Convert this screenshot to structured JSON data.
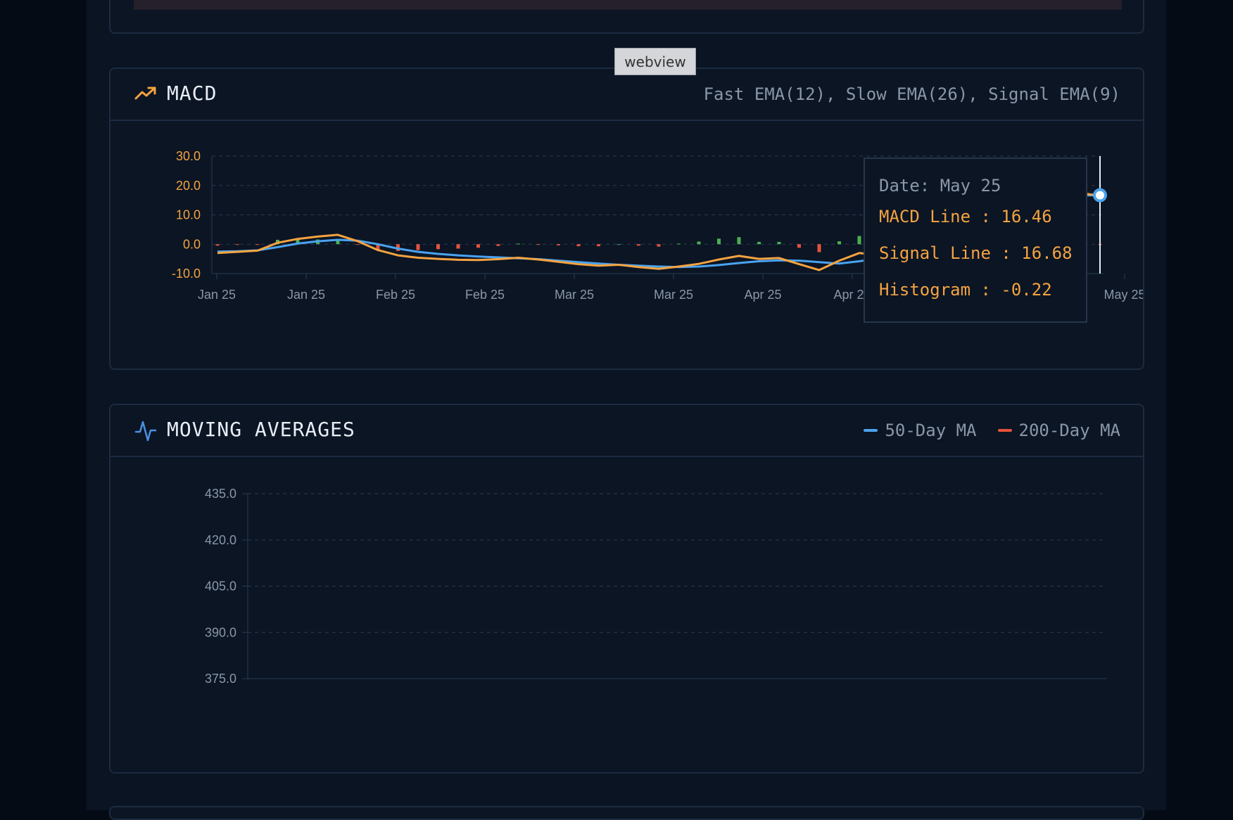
{
  "overlay": {
    "badge": "webview"
  },
  "macd_panel": {
    "title": "MACD",
    "subtitle": "Fast EMA(12), Slow EMA(26), Signal EMA(9)",
    "tooltip": {
      "date": "Date: May 25",
      "macd": "MACD Line : 16.46",
      "signal": "Signal Line : 16.68",
      "histogram": "Histogram : -0.22"
    }
  },
  "ma_panel": {
    "title": "MOVING AVERAGES",
    "legend": [
      {
        "label": "50-Day MA",
        "color": "#4aa3f0"
      },
      {
        "label": "200-Day MA",
        "color": "#e5533d"
      }
    ]
  },
  "colors": {
    "macd_line": "#f5a340",
    "signal_line": "#4aa3f0",
    "hist_positive": "#4caf50",
    "hist_negative": "#e5533d",
    "accent_orange": "#f5a340",
    "accent_blue": "#4a90e2"
  },
  "chart_data": [
    {
      "type": "line",
      "title": "MACD",
      "y_ticks": [
        "30.0",
        "20.0",
        "10.0",
        "0.0",
        "-10.0"
      ],
      "ylim": [
        -10,
        30
      ],
      "x_ticks": [
        "Jan 25",
        "Jan 25",
        "Feb 25",
        "Feb 25",
        "Mar 25",
        "Mar 25",
        "Apr 25",
        "Apr 25",
        "May 25",
        "May 25"
      ],
      "grid": true,
      "series": [
        {
          "name": "MACD Line",
          "values": [
            -3.0,
            -2.6,
            -2.2,
            0.5,
            1.8,
            2.6,
            3.2,
            1.0,
            -2.0,
            -3.8,
            -4.6,
            -5.0,
            -5.3,
            -5.4,
            -5.1,
            -4.6,
            -5.2,
            -6.0,
            -6.8,
            -7.3,
            -7.0,
            -7.8,
            -8.4,
            -7.6,
            -6.7,
            -5.2,
            -4.0,
            -5.0,
            -4.7,
            -6.8,
            -8.8,
            -5.6,
            -3.0,
            -3.8,
            -5.0,
            -4.0,
            -2.5,
            3.0,
            8.0,
            12.0,
            15.0,
            16.0,
            17.2,
            17.5,
            16.46
          ]
        },
        {
          "name": "Signal Line",
          "values": [
            -2.5,
            -2.4,
            -2.1,
            -1.0,
            0.2,
            1.0,
            1.5,
            1.2,
            0.0,
            -1.5,
            -2.6,
            -3.3,
            -3.8,
            -4.2,
            -4.5,
            -4.8,
            -5.1,
            -5.6,
            -6.1,
            -6.6,
            -7.0,
            -7.3,
            -7.6,
            -7.8,
            -7.6,
            -7.1,
            -6.4,
            -5.8,
            -5.5,
            -5.6,
            -6.1,
            -6.6,
            -5.8,
            -4.8,
            -4.4,
            -4.0,
            -3.0,
            0.0,
            4.0,
            8.0,
            11.5,
            14.0,
            15.8,
            16.6,
            16.68
          ]
        },
        {
          "name": "Histogram",
          "values": [
            -0.5,
            -0.2,
            -0.1,
            1.5,
            1.6,
            1.6,
            1.7,
            -0.2,
            -2.0,
            -2.3,
            -2.0,
            -1.7,
            -1.5,
            -1.2,
            -0.6,
            0.2,
            -0.1,
            -0.4,
            -0.7,
            -0.7,
            0.0,
            -0.5,
            -0.8,
            0.2,
            0.9,
            1.9,
            2.4,
            0.8,
            0.8,
            -1.2,
            -2.7,
            1.0,
            2.8,
            1.0,
            -0.6,
            0.0,
            0.5,
            3.0,
            4.0,
            4.0,
            3.5,
            2.0,
            1.4,
            0.9,
            -0.22
          ]
        }
      ]
    },
    {
      "type": "line",
      "title": "MOVING AVERAGES",
      "y_ticks": [
        "435.0",
        "420.0",
        "405.0",
        "390.0",
        "375.0"
      ],
      "ylim": [
        375,
        435
      ],
      "grid": true,
      "series": [
        {
          "name": "50-Day MA",
          "values": []
        },
        {
          "name": "200-Day MA",
          "values": []
        }
      ]
    }
  ]
}
